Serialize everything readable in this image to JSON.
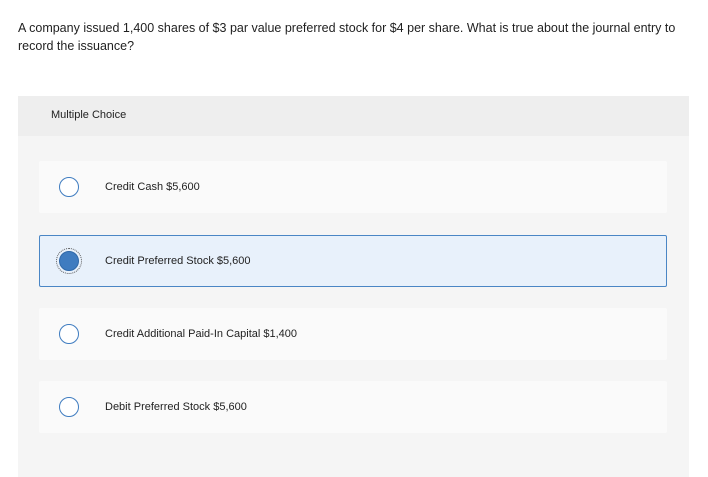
{
  "question": {
    "text": "A company issued 1,400 shares of $3 par value preferred stock for $4 per share. What is true about the journal entry to record the issuance?"
  },
  "panel": {
    "title": "Multiple Choice"
  },
  "options": [
    {
      "label": "Credit Cash $5,600",
      "selected": false
    },
    {
      "label": "Credit Preferred Stock $5,600",
      "selected": true
    },
    {
      "label": "Credit Additional Paid-In Capital $1,400",
      "selected": false
    },
    {
      "label": "Debit Preferred Stock $5,600",
      "selected": false
    }
  ],
  "colors": {
    "accent": "#3f7cc0",
    "selected_background": "#e8f1fb",
    "panel_background": "#f5f5f5"
  }
}
